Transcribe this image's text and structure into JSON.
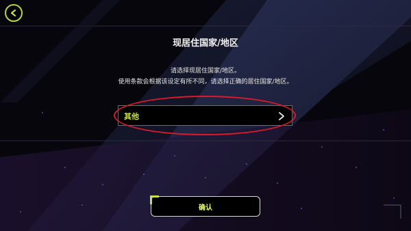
{
  "header": {
    "back_icon": "chevron-left-icon"
  },
  "dialog": {
    "title": "现居住国家/地区",
    "description_line1": "请选择现居住国家/地区。",
    "description_line2": "使用条款会根据该设定有所不同，请选择正确的居住国家/地区。",
    "selector": {
      "value": "其他",
      "icon": "chevron-right-icon"
    },
    "confirm_label": "确认"
  },
  "colors": {
    "accent": "#c7e04a",
    "highlight": "#e0182b",
    "background": "#07060d"
  }
}
